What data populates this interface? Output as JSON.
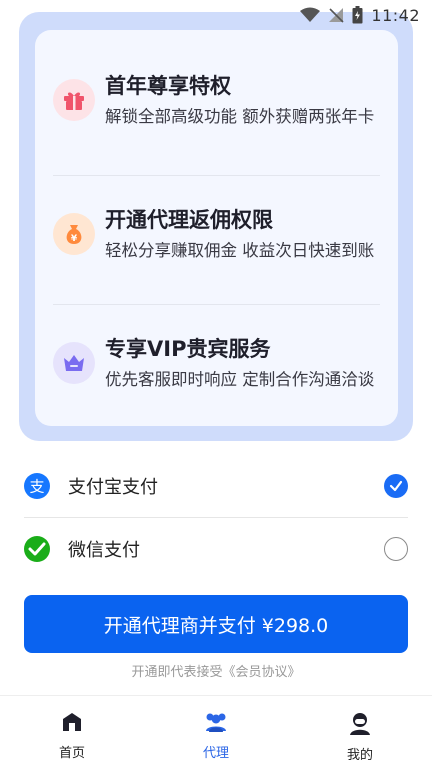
{
  "status_bar": {
    "time": "11:42",
    "icons": [
      "wifi-icon",
      "signal-off-icon",
      "battery-icon"
    ]
  },
  "benefits": [
    {
      "title": "首年尊享特权",
      "desc": "解锁全部高级功能 额外获赠两张年卡",
      "icon": "gift-icon",
      "color": "#f0546b"
    },
    {
      "title": "开通代理返佣权限",
      "desc": "轻松分享赚取佣金 收益次日快速到账",
      "icon": "money-bag-icon",
      "color": "#ff8a3d"
    },
    {
      "title": "专享VIP贵宾服务",
      "desc": "优先客服即时响应 定制合作沟通洽谈",
      "icon": "crown-icon",
      "color": "#7a6cf0"
    }
  ],
  "payment": {
    "methods": [
      {
        "label": "支付宝支付",
        "icon": "alipay-icon",
        "selected": true
      },
      {
        "label": "微信支付",
        "icon": "wechat-pay-icon",
        "selected": false
      }
    ]
  },
  "submit": {
    "label": "开通代理商并支付 ¥298.0"
  },
  "agreement": {
    "text": "开通即代表接受《会员协议》"
  },
  "tabs": [
    {
      "label": "首页",
      "icon": "home-icon",
      "active": false
    },
    {
      "label": "代理",
      "icon": "agent-icon",
      "active": true
    },
    {
      "label": "我的",
      "icon": "profile-icon",
      "active": false
    }
  ],
  "colors": {
    "primary": "#0a63f0",
    "card_bg": "#cfdcfb",
    "alipay": "#1677ff",
    "wechat": "#1aad19"
  }
}
